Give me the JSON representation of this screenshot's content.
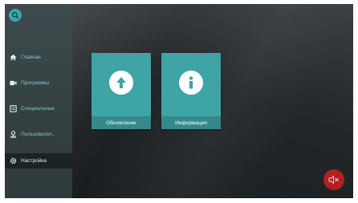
{
  "sidebar": {
    "search_icon": "search-icon",
    "items": [
      {
        "label": "Главная",
        "icon": "home-icon",
        "active": false
      },
      {
        "label": "Программы",
        "icon": "programs-icon",
        "active": false
      },
      {
        "label": "Специальные",
        "icon": "special-icon",
        "active": false
      },
      {
        "label": "Пользовател..",
        "icon": "user-icon",
        "active": false
      },
      {
        "label": "Настройка",
        "icon": "gear-icon",
        "active": true
      }
    ]
  },
  "main": {
    "tiles": [
      {
        "label": "Обновление",
        "icon": "arrow-up-icon"
      },
      {
        "label": "Информация",
        "icon": "info-icon"
      }
    ],
    "mute_icon": "speaker-muted-icon"
  },
  "colors": {
    "accent": "#3fa4a6",
    "sidebar_text": "#7ec9cf",
    "mute": "#b32020"
  }
}
